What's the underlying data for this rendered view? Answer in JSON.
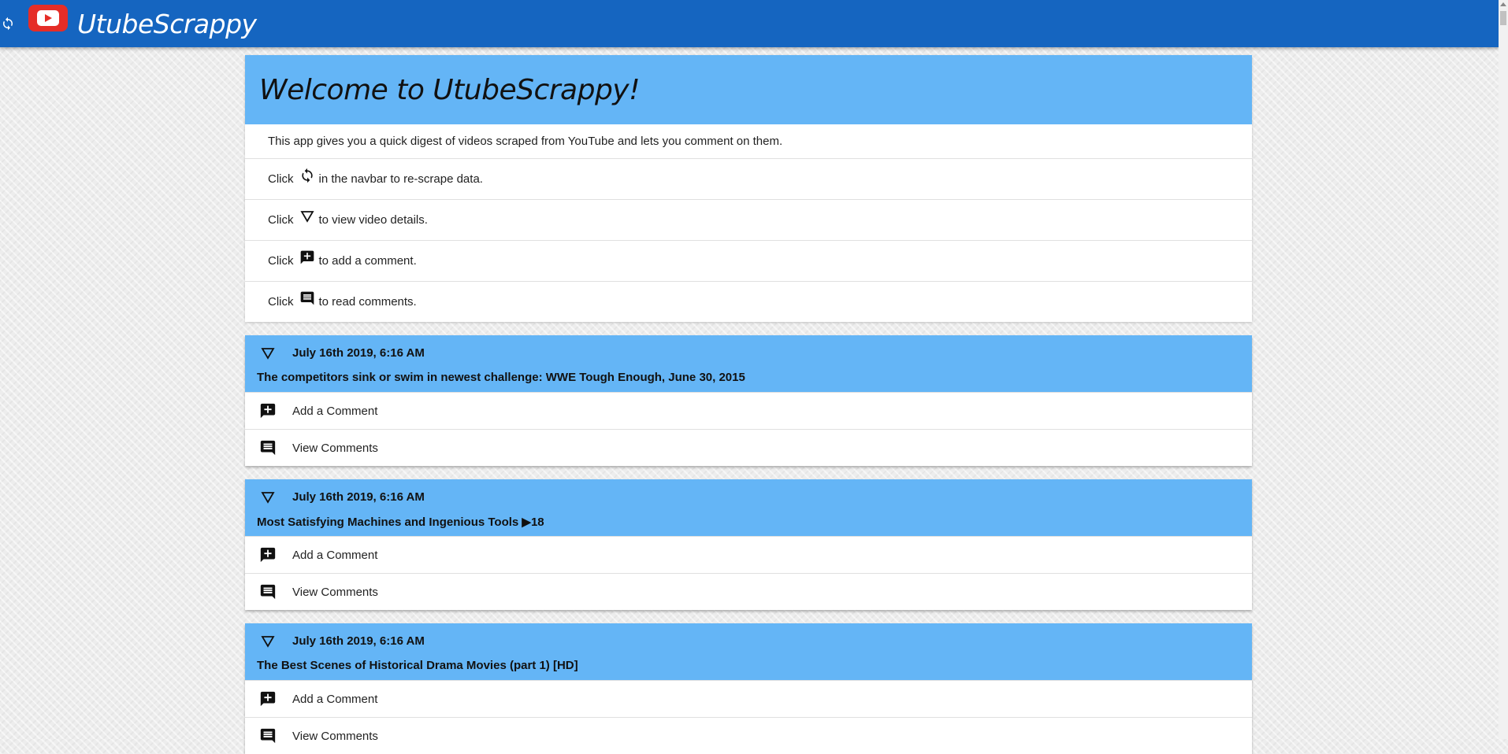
{
  "navbar": {
    "refresh_icon": "refresh-icon",
    "logo_icon": "youtube-logo-icon",
    "brand": "UtubeScrappy"
  },
  "welcome": {
    "title": "Welcome to UtubeScrappy!",
    "intro": "This app gives you a quick digest of videos scraped from YouTube and lets you comment on them.",
    "instructions": [
      {
        "prefix": "Click",
        "icon": "refresh-icon",
        "suffix": "in the navbar to re-scrape data."
      },
      {
        "prefix": "Click",
        "icon": "triangle-down-icon",
        "suffix": "to view video details."
      },
      {
        "prefix": "Click",
        "icon": "add-comment-icon",
        "suffix": "to add a comment."
      },
      {
        "prefix": "Click",
        "icon": "comment-icon",
        "suffix": "to read comments."
      }
    ]
  },
  "videos": [
    {
      "date": "July 16th 2019, 6:16 AM",
      "title": "The competitors sink or swim in newest challenge: WWE Tough Enough, June 30, 2015",
      "add_label": "Add a Comment",
      "view_label": "View Comments"
    },
    {
      "date": "July 16th 2019, 6:16 AM",
      "title": "Most Satisfying Machines and Ingenious Tools ▶18",
      "add_label": "Add a Comment",
      "view_label": "View Comments"
    },
    {
      "date": "July 16th 2019, 6:16 AM",
      "title": "The Best Scenes of Historical Drama Movies (part 1) [HD]",
      "add_label": "Add a Comment",
      "view_label": "View Comments"
    }
  ],
  "colors": {
    "navbar": "#1565c0",
    "header": "#64b5f6",
    "logo_red": "#e52d27"
  }
}
